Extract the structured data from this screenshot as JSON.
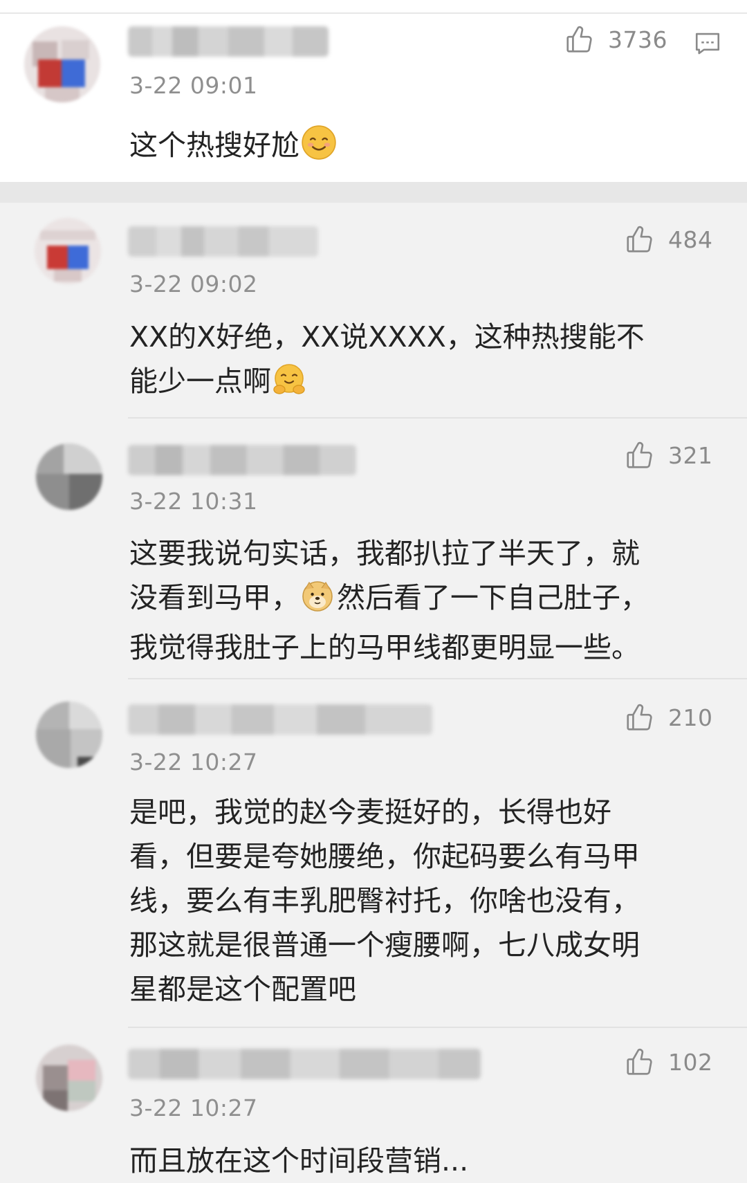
{
  "main_comment": {
    "time": "3-22 09:01",
    "likes": "3736",
    "text": "这个热搜好尬",
    "emoji": "smile-emoji"
  },
  "replies": [
    {
      "time": "3-22 09:02",
      "likes": "484",
      "lines": [
        "XX的X好绝，XX说XXXX，这种热搜能不",
        "能少一点啊"
      ],
      "emoji": "hug-emoji"
    },
    {
      "time": "3-22 10:31",
      "likes": "321",
      "lines": [
        "这要我说句实话，我都扒拉了半天了，就",
        "没看到马甲，",
        "然后看了一下自己肚子，",
        "我觉得我肚子上的马甲线都更明显一些。"
      ],
      "emoji": "doge-emoji"
    },
    {
      "time": "3-22 10:27",
      "likes": "210",
      "lines": [
        "是吧，我觉的赵今麦挺好的，长得也好",
        "看，但要是夸她腰绝，你起码要么有马甲",
        "线，要么有丰乳肥臀衬托，你啥也没有，",
        "那这就是很普通一个瘦腰啊，七八成女明",
        "星都是这个配置吧"
      ]
    },
    {
      "time": "3-22 10:27",
      "likes": "102",
      "lines": [
        "而且放在这个时间段营销..."
      ]
    }
  ],
  "icons": {
    "like": "thumbs-up-icon",
    "comment": "comment-icon"
  },
  "colors": {
    "background": "#f2f2f2",
    "card": "#ffffff",
    "text": "#232323",
    "meta": "#8f8f8f",
    "divider": "#e2e2e2"
  }
}
